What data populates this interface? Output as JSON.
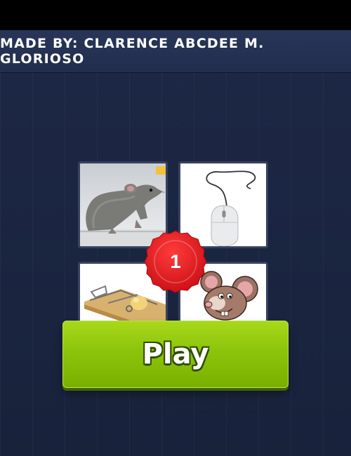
{
  "header": {
    "credit": "MADE BY: CLARENCE ABCDEE M. GLORIOSO"
  },
  "puzzle": {
    "tiles": [
      {
        "icon": "rat-photo-icon"
      },
      {
        "icon": "computer-mouse-icon"
      },
      {
        "icon": "mousetrap-icon"
      },
      {
        "icon": "cartoon-mouse-icon"
      }
    ],
    "level_badge": "1"
  },
  "actions": {
    "play_label": "Play"
  },
  "colors": {
    "background": "#1b2540",
    "banner": "#283558",
    "play_button": "#8cc40c",
    "badge": "#e0191e"
  }
}
